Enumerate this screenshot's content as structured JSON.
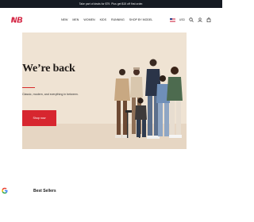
{
  "promo": {
    "text": "Take part of deals for $79. Plus get $15 off first order."
  },
  "nav": {
    "items": [
      {
        "label": "NEW"
      },
      {
        "label": "MEN"
      },
      {
        "label": "WOMEN"
      },
      {
        "label": "KIDS"
      },
      {
        "label": "RUNNING"
      },
      {
        "label": "SHOP BY MODEL"
      }
    ]
  },
  "header": {
    "currency": "USD",
    "logo_text": "NB"
  },
  "hero": {
    "title": "We’re back",
    "subtitle": "Classic, modern, and everything in between.",
    "cta_label": "Shop now"
  },
  "section": {
    "title": "Best Sellers"
  },
  "colors": {
    "accent": "#d7262f",
    "promo_bg": "#151a22",
    "hero_bg": "#efe3d3"
  },
  "icons": [
    "nb-logo",
    "us-flag-icon",
    "search-icon",
    "user-icon",
    "bag-icon",
    "google-icon"
  ]
}
